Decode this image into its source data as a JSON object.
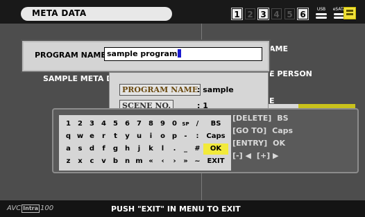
{
  "header": {
    "title": "META DATA",
    "slots": [
      {
        "label": "1",
        "state": "on"
      },
      {
        "label": "2",
        "state": "off"
      },
      {
        "label": "3",
        "state": "on"
      },
      {
        "label": "4",
        "state": "off"
      },
      {
        "label": "5",
        "state": "off"
      },
      {
        "label": "6",
        "state": "on"
      }
    ],
    "usb_label": "USB",
    "esata_label": "eSATA",
    "battery_icon": "battery-icon",
    "colors": {
      "battery": "#f0e13a",
      "ok_key": "#f2ea3b"
    }
  },
  "background": {
    "right_items": [
      "AME",
      "E PERSON",
      "E"
    ],
    "left_item": "SAMPLE META D"
  },
  "program_name_dialog": {
    "label": "PROGRAM NAME",
    "value": "sample program"
  },
  "info_popup": {
    "rows": [
      {
        "tag": "PROGRAM NAME",
        "value": ": sample"
      },
      {
        "tag": "SCENE NO.",
        "value": ": 1"
      }
    ]
  },
  "keyboard": {
    "rows": [
      [
        "1",
        "2",
        "3",
        "4",
        "5",
        "6",
        "7",
        "8",
        "9",
        "0",
        "SP",
        "/",
        "BS"
      ],
      [
        "q",
        "w",
        "e",
        "r",
        "t",
        "y",
        "u",
        "i",
        "o",
        "p",
        "-",
        ":",
        "Caps"
      ],
      [
        "a",
        "s",
        "d",
        "f",
        "g",
        "h",
        "j",
        "k",
        "l",
        ".",
        "_",
        "#",
        "OK"
      ],
      [
        "z",
        "x",
        "c",
        "v",
        "b",
        "n",
        "m",
        "«",
        "‹",
        "›",
        "»",
        "~",
        "EXIT"
      ]
    ],
    "help": [
      {
        "left": "[DELETE]",
        "right": "BS"
      },
      {
        "left": "[GO TO]",
        "right": "Caps"
      },
      {
        "left": "[ENTRY]",
        "right": "OK"
      },
      {
        "left": "[-] ◀",
        "right": "[+] ▶"
      }
    ]
  },
  "footer": {
    "logo_avc": "AVC",
    "logo_intra": "Intra",
    "logo_num": "100",
    "message": "PUSH \"EXIT\" IN MENU TO EXIT"
  }
}
